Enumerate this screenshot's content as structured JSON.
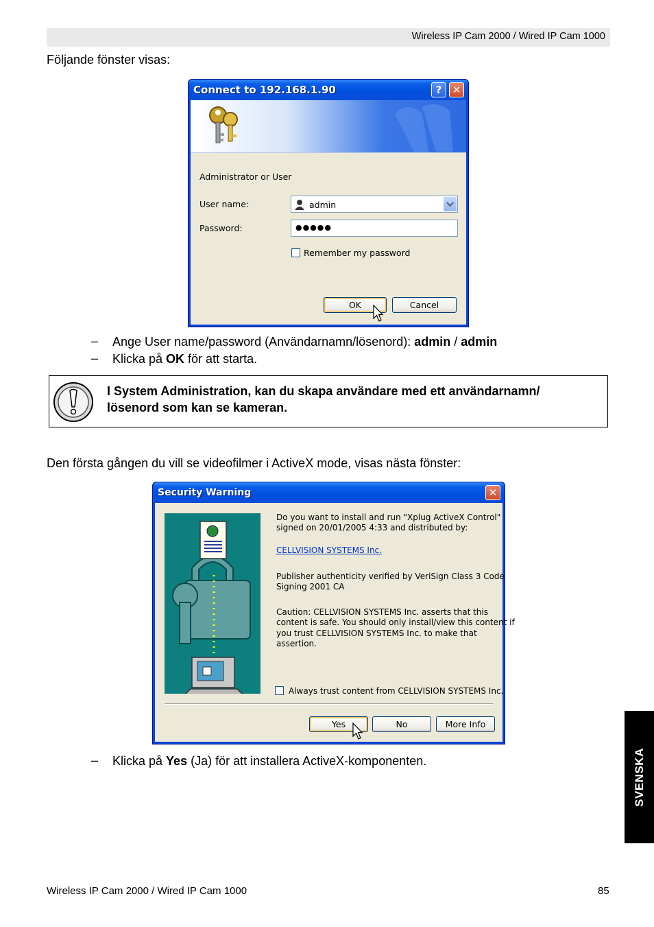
{
  "header": {
    "title": "Wireless IP Cam 2000 / Wired IP Cam 1000"
  },
  "intro": "Följande fönster visas:",
  "login_dialog": {
    "title": "Connect to 192.168.1.90",
    "help_glyph": "?",
    "close_glyph": "✕",
    "realm": "Administrator or User",
    "username_label": "User name:",
    "username_value": "admin",
    "password_label": "Password:",
    "password_value": "●●●●●",
    "remember_label": "Remember my password",
    "ok_label": "OK",
    "cancel_label": "Cancel",
    "icons": [
      "keys-icon",
      "user-icon",
      "dropdown-arrow-icon",
      "mouse-cursor-icon"
    ]
  },
  "steps1": [
    {
      "dash": "–",
      "pre": "Ange User name/password (Användarnamn/lösenord): ",
      "b1": "admin",
      "mid": " / ",
      "b2": "admin"
    },
    {
      "dash": "–",
      "pre": "Klicka på ",
      "b1": "OK",
      "post": " för att starta."
    }
  ],
  "note": {
    "line1": "I System Administration, kan du skapa användare med ett användarnamn/",
    "line2": "lösenord som kan se kameran.",
    "icon": "exclamation-icon"
  },
  "activex_intro": "Den första gången du vill se videofilmer i ActiveX mode, visas nästa fönster:",
  "security_dialog": {
    "title": "Security Warning",
    "close_glyph": "✕",
    "line1": "Do you want to install and run \"Xplug ActiveX Control\"",
    "line2": "signed on 20/01/2005 4:33 and distributed by:",
    "publisher_link": "CELLVISION SYSTEMS Inc.",
    "auth1": "Publisher authenticity verified by VeriSign Class 3 Code",
    "auth2": "Signing 2001 CA",
    "caution1": "Caution: CELLVISION SYSTEMS Inc. asserts that this",
    "caution2": "content is safe.  You should only install/view this content if",
    "caution3": "you trust CELLVISION SYSTEMS Inc. to make that",
    "caution4": "assertion.",
    "trust_label": "Always trust content from CELLVISION SYSTEMS Inc.",
    "yes_label": "Yes",
    "no_label": "No",
    "more_label": "More Info",
    "icons": [
      "certificate-icon",
      "computer-icon",
      "lock-icon"
    ]
  },
  "steps2": [
    {
      "dash": "–",
      "pre": "Klicka på ",
      "b1": "Yes",
      "post": " (Ja) för att installera ActiveX-komponenten."
    }
  ],
  "side_tab": "SVENSKA",
  "footer": {
    "left": "Wireless IP Cam 2000 / Wired IP Cam 1000",
    "page": "85"
  }
}
